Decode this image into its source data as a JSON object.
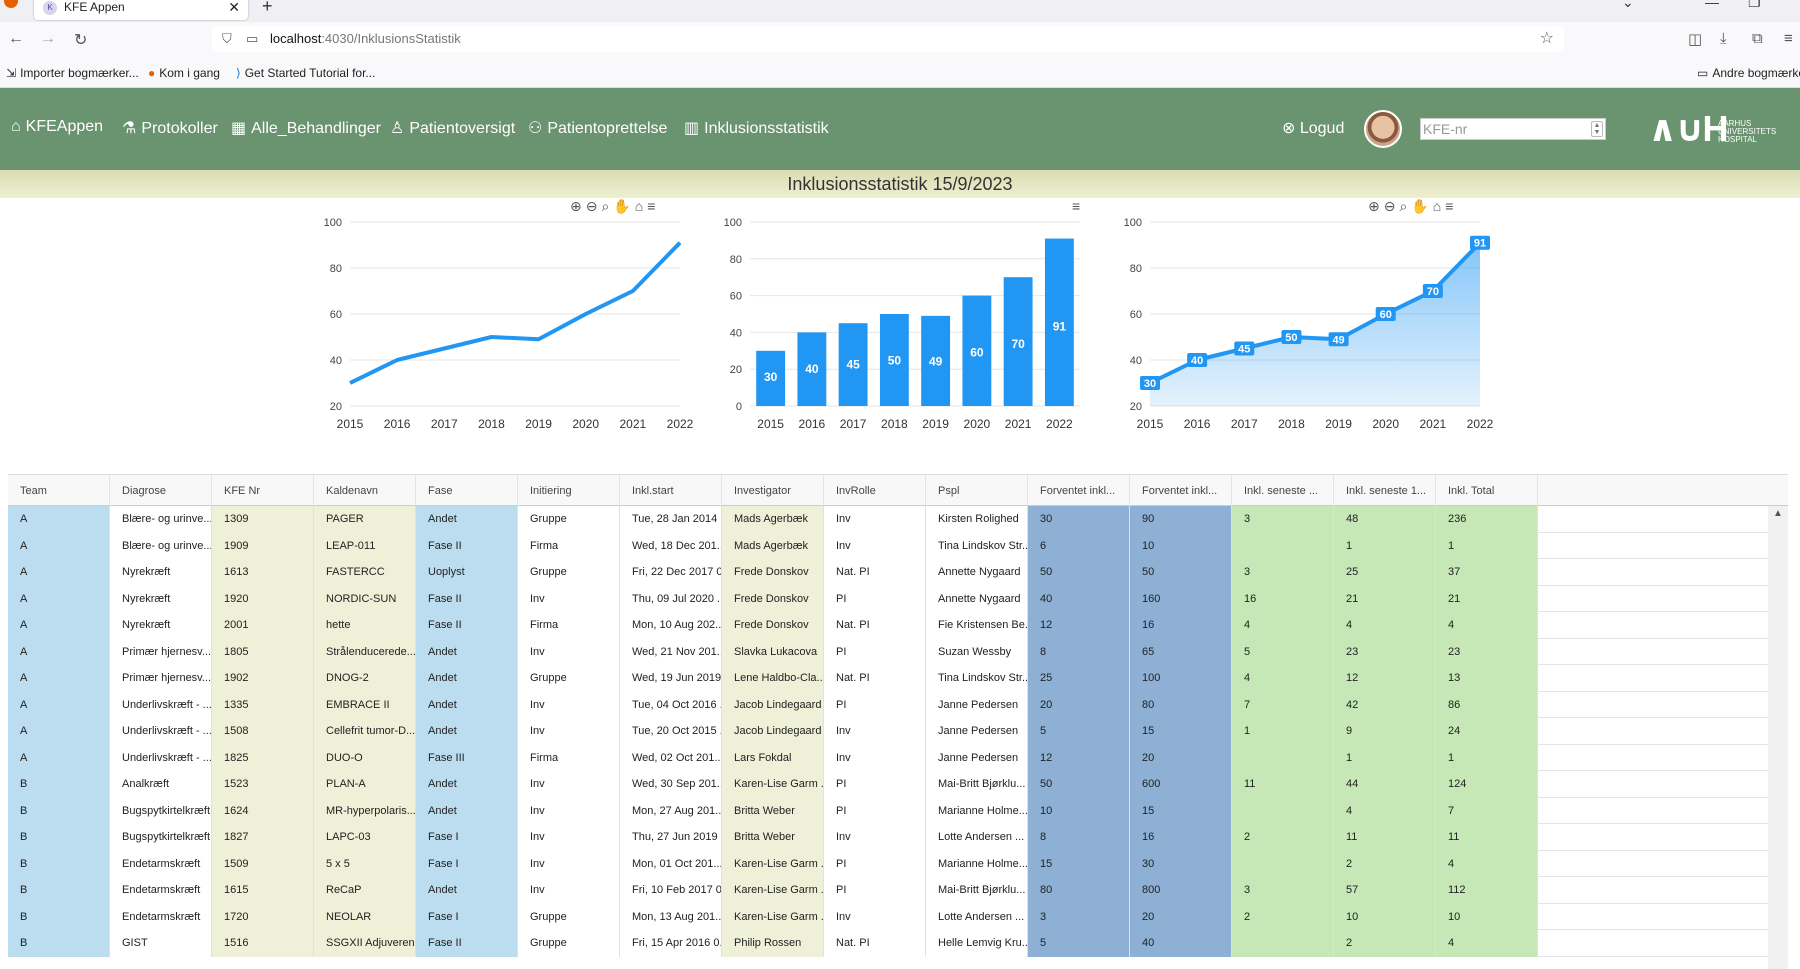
{
  "browser": {
    "tab_title": "KFE Appen",
    "url_host": "localhost",
    "url_path": ":4030/InklusionsStatistik",
    "bookmarks": [
      "Importer bogmærker...",
      "Kom i gang",
      "Get Started Tutorial for...",
      "Andre bogmærker"
    ]
  },
  "appnav": {
    "items": [
      "KFEAppen",
      "Protokoller",
      "Alle_Behandlinger",
      "Patientoversigt",
      "Patientoprettelse",
      "Inklusionsstatistik"
    ],
    "logout": "Logud",
    "kfe_placeholder": "KFE-nr",
    "logo_text": "AARHUS UNIVERSITETS HOSPITAL"
  },
  "page_title": "Inklusionsstatistik 15/9/2023",
  "chart_data": [
    {
      "type": "line",
      "x": [
        2015,
        2016,
        2017,
        2018,
        2019,
        2020,
        2021,
        2022
      ],
      "values": [
        30,
        40,
        45,
        50,
        49,
        60,
        70,
        91
      ],
      "ylim": [
        20,
        100
      ],
      "yticks": [
        20,
        40,
        60,
        80,
        100
      ],
      "grid": true,
      "color": "#2196f3"
    },
    {
      "type": "bar",
      "x": [
        2015,
        2016,
        2017,
        2018,
        2019,
        2020,
        2021,
        2022
      ],
      "values": [
        30,
        40,
        45,
        50,
        49,
        60,
        70,
        91
      ],
      "ylim": [
        0,
        100
      ],
      "yticks": [
        0,
        20,
        40,
        60,
        80,
        100
      ],
      "grid": true,
      "color": "#2196f3"
    },
    {
      "type": "area",
      "x": [
        2015,
        2016,
        2017,
        2018,
        2019,
        2020,
        2021,
        2022
      ],
      "values": [
        30,
        40,
        45,
        50,
        49,
        60,
        70,
        91
      ],
      "ylim": [
        20,
        100
      ],
      "yticks": [
        20,
        40,
        60,
        80,
        100
      ],
      "grid": true,
      "color": "#2196f3"
    }
  ],
  "table": {
    "headers": [
      "Team",
      "Diagrose",
      "KFE Nr",
      "Kaldenavn",
      "Fase",
      "Initiering",
      "Inkl.start",
      "Investigator",
      "InvRolle",
      "Pspl",
      "Forventet inkl...",
      "Forventet inkl...",
      "Inkl. seneste ...",
      "Inkl. seneste 1...",
      "Inkl. Total"
    ],
    "rows": [
      [
        "A",
        "Blære- og urinve...",
        "1309",
        "PAGER",
        "Andet",
        "Gruppe",
        "Tue, 28 Jan 2014 ...",
        "Mads Agerbæk",
        "Inv",
        "Kirsten Rolighed",
        "30",
        "90",
        "3",
        "48",
        "236"
      ],
      [
        "A",
        "Blære- og urinve...",
        "1909",
        "LEAP-011",
        "Fase II",
        "Firma",
        "Wed, 18 Dec 201...",
        "Mads Agerbæk",
        "Inv",
        "Tina Lindskov Str...",
        "6",
        "10",
        "",
        "1",
        "1"
      ],
      [
        "A",
        "Nyrekræft",
        "1613",
        "FASTERCC",
        "Uoplyst",
        "Gruppe",
        "Fri, 22 Dec 2017 0...",
        "Frede Donskov",
        "Nat. PI",
        "Annette Nygaard",
        "50",
        "50",
        "3",
        "25",
        "37"
      ],
      [
        "A",
        "Nyrekræft",
        "1920",
        "NORDIC-SUN",
        "Fase II",
        "Inv",
        "Thu, 09 Jul 2020 ...",
        "Frede Donskov",
        "PI",
        "Annette Nygaard",
        "40",
        "160",
        "16",
        "21",
        "21"
      ],
      [
        "A",
        "Nyrekræft",
        "2001",
        "hette",
        "Fase II",
        "Firma",
        "Mon, 10 Aug 202...",
        "Frede Donskov",
        "Nat. PI",
        "Fie Kristensen Be...",
        "12",
        "16",
        "4",
        "4",
        "4"
      ],
      [
        "A",
        "Primær hjernesv...",
        "1805",
        "Strålenducerede...",
        "Andet",
        "Inv",
        "Wed, 21 Nov 201...",
        "Slavka Lukacova",
        "PI",
        "Suzan Wessby",
        "8",
        "65",
        "5",
        "23",
        "23"
      ],
      [
        "A",
        "Primær hjernesv...",
        "1902",
        "DNOG-2",
        "Andet",
        "Gruppe",
        "Wed, 19 Jun 2019...",
        "Lene Haldbo-Cla...",
        "Nat. PI",
        "Tina Lindskov Str...",
        "25",
        "100",
        "4",
        "12",
        "13"
      ],
      [
        "A",
        "Underlivskræft - ...",
        "1335",
        "EMBRACE II",
        "Andet",
        "Inv",
        "Tue, 04 Oct 2016 ...",
        "Jacob Lindegaard",
        "PI",
        "Janne Pedersen",
        "20",
        "80",
        "7",
        "42",
        "86"
      ],
      [
        "A",
        "Underlivskræft - ...",
        "1508",
        "Cellefrit tumor-D...",
        "Andet",
        "Inv",
        "Tue, 20 Oct 2015 ...",
        "Jacob Lindegaard",
        "Inv",
        "Janne Pedersen",
        "5",
        "15",
        "1",
        "9",
        "24"
      ],
      [
        "A",
        "Underlivskræft - ...",
        "1825",
        "DUO-O",
        "Fase III",
        "Firma",
        "Wed, 02 Oct 201...",
        "Lars Fokdal",
        "Inv",
        "Janne Pedersen",
        "12",
        "20",
        "",
        "1",
        "1"
      ],
      [
        "B",
        "Analkræft",
        "1523",
        "PLAN-A",
        "Andet",
        "Inv",
        "Wed, 30 Sep 201...",
        "Karen-Lise Garm ...",
        "PI",
        "Mai-Britt Bjørklu...",
        "50",
        "600",
        "11",
        "44",
        "124"
      ],
      [
        "B",
        "Bugspytkirtelkræft",
        "1624",
        "MR-hyperpolaris...",
        "Andet",
        "Inv",
        "Mon, 27 Aug 201...",
        "Britta Weber",
        "PI",
        "Marianne Holme...",
        "10",
        "15",
        "",
        "4",
        "7"
      ],
      [
        "B",
        "Bugspytkirtelkræft",
        "1827",
        "LAPC-03",
        "Fase I",
        "Inv",
        "Thu, 27 Jun 2019 ...",
        "Britta Weber",
        "Inv",
        "Lotte Andersen ...",
        "8",
        "16",
        "2",
        "11",
        "11"
      ],
      [
        "B",
        "Endetarmskræft",
        "1509",
        "5 x 5",
        "Fase I",
        "Inv",
        "Mon, 01 Oct 201...",
        "Karen-Lise Garm ...",
        "PI",
        "Marianne Holme...",
        "15",
        "30",
        "",
        "2",
        "4"
      ],
      [
        "B",
        "Endetarmskræft",
        "1615",
        "ReCaP",
        "Andet",
        "Inv",
        "Fri, 10 Feb 2017 0...",
        "Karen-Lise Garm ...",
        "PI",
        "Mai-Britt Bjørklu...",
        "80",
        "800",
        "3",
        "57",
        "112"
      ],
      [
        "B",
        "Endetarmskræft",
        "1720",
        "NEOLAR",
        "Fase I",
        "Gruppe",
        "Mon, 13 Aug 201...",
        "Karen-Lise Garm ...",
        "Inv",
        "Lotte Andersen ...",
        "3",
        "20",
        "2",
        "10",
        "10"
      ],
      [
        "B",
        "GIST",
        "1516",
        "SSGXII Adjuveren...",
        "Fase II",
        "Gruppe",
        "Fri, 15 Apr 2016 0...",
        "Philip Rossen",
        "Nat. PI",
        "Helle Lemvig Kru...",
        "5",
        "40",
        "",
        "2",
        "4"
      ]
    ]
  }
}
